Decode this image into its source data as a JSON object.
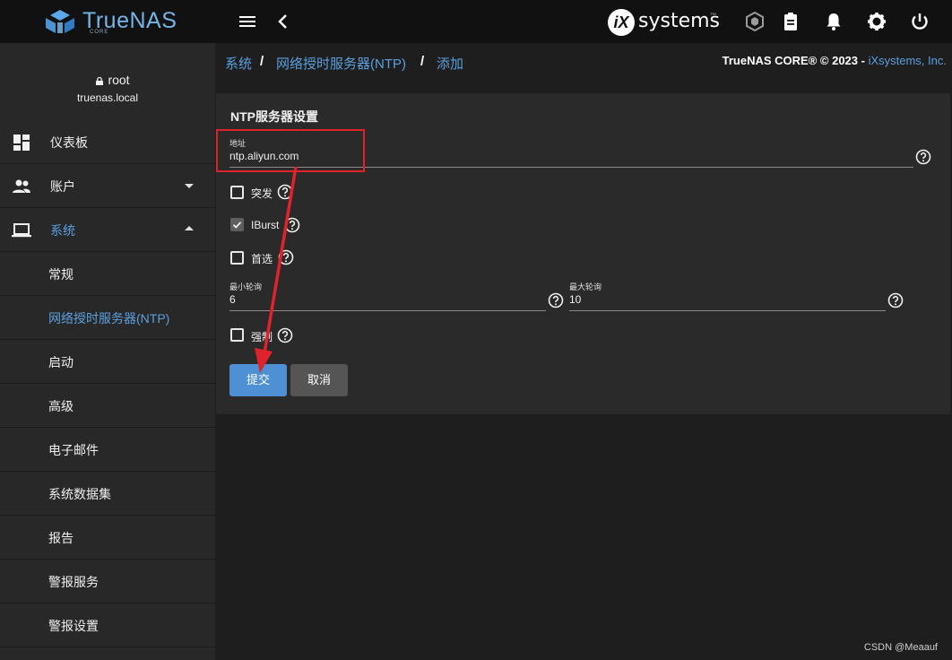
{
  "topbar": {
    "brand": "TrueNAS",
    "brand_sub": "CORE",
    "vendor_logo_mark": "iX",
    "vendor_logo_text": "systems",
    "vendor_tm": "™"
  },
  "sidebar": {
    "user": "root",
    "host": "truenas.local",
    "items": [
      {
        "label": "仪表板",
        "icon": "dashboard-icon"
      },
      {
        "label": "账户",
        "icon": "people-icon"
      },
      {
        "label": "系统",
        "icon": "laptop-icon"
      },
      {
        "label": "常规"
      },
      {
        "label": "网络授时服务器(NTP)"
      },
      {
        "label": "启动"
      },
      {
        "label": "高级"
      },
      {
        "label": "电子邮件"
      },
      {
        "label": "系统数据集"
      },
      {
        "label": "报告"
      },
      {
        "label": "警报服务"
      },
      {
        "label": "警报设置"
      }
    ]
  },
  "breadcrumb": {
    "items": [
      "系统",
      "网络授时服务器(NTP)",
      "添加"
    ],
    "sep": "/"
  },
  "copyright": {
    "text": "TrueNAS CORE® © 2023 - ",
    "link": "iXsystems, Inc."
  },
  "form": {
    "title": "NTP服务器设置",
    "address_label": "地址",
    "address_value": "ntp.aliyun.com",
    "burst_label": "突发",
    "burst_checked": false,
    "iburst_label": "IBurst",
    "iburst_checked": true,
    "prefer_label": "首选",
    "prefer_checked": false,
    "minpoll_label": "最小轮询",
    "minpoll_value": "6",
    "maxpoll_label": "最大轮询",
    "maxpoll_value": "10",
    "force_label": "强制",
    "force_checked": false,
    "submit_label": "提交",
    "cancel_label": "取消"
  },
  "watermark": "CSDN @Meaauf",
  "colors": {
    "accent": "#5aa0e0",
    "primary_button": "#4f8fd3",
    "annotation": "#e0222a"
  }
}
